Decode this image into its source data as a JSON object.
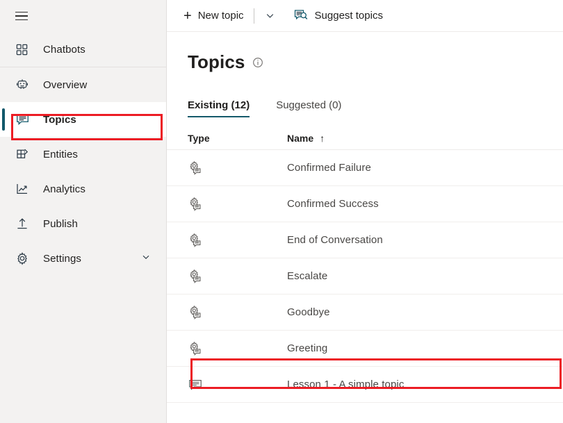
{
  "sidebar": {
    "menu_toggle": "hamburger-icon",
    "items": [
      {
        "label": "Chatbots",
        "icon": "grid-icon",
        "selected": false,
        "chevron": false
      },
      {
        "label": "Overview",
        "icon": "bot-icon",
        "selected": false,
        "chevron": false
      },
      {
        "label": "Topics",
        "icon": "speech-bubble-icon",
        "selected": true,
        "chevron": false
      },
      {
        "label": "Entities",
        "icon": "entities-icon",
        "selected": false,
        "chevron": false
      },
      {
        "label": "Analytics",
        "icon": "chart-line-icon",
        "selected": false,
        "chevron": false
      },
      {
        "label": "Publish",
        "icon": "upload-icon",
        "selected": false,
        "chevron": false
      },
      {
        "label": "Settings",
        "icon": "gear-icon",
        "selected": false,
        "chevron": true
      }
    ]
  },
  "toolbar": {
    "new_topic_label": "New topic",
    "new_topic_icon": "plus-icon",
    "new_topic_caret_icon": "chevron-down-icon",
    "suggest_topics_label": "Suggest topics",
    "suggest_topics_icon": "suggest-topics-icon"
  },
  "page": {
    "title": "Topics",
    "info_icon": "info-icon"
  },
  "tabs": [
    {
      "label": "Existing (12)",
      "active": true
    },
    {
      "label": "Suggested (0)",
      "active": false
    }
  ],
  "table": {
    "columns": [
      {
        "key": "type",
        "label": "Type",
        "sort": ""
      },
      {
        "key": "name",
        "label": "Name",
        "sort": "↑"
      }
    ],
    "rows": [
      {
        "type_icon": "system-topic-icon",
        "name": "Confirmed Failure",
        "highlighted": false
      },
      {
        "type_icon": "system-topic-icon",
        "name": "Confirmed Success",
        "highlighted": false
      },
      {
        "type_icon": "system-topic-icon",
        "name": "End of Conversation",
        "highlighted": false
      },
      {
        "type_icon": "system-topic-icon",
        "name": "Escalate",
        "highlighted": false
      },
      {
        "type_icon": "system-topic-icon",
        "name": "Goodbye",
        "highlighted": false
      },
      {
        "type_icon": "system-topic-icon",
        "name": "Greeting",
        "highlighted": true
      },
      {
        "type_icon": "custom-topic-icon",
        "name": "Lesson 1 - A simple topic",
        "highlighted": false
      }
    ]
  },
  "annotations": [
    {
      "name": "sidebar-topics-highlight",
      "color": "#ec1c24"
    },
    {
      "name": "greeting-row-highlight",
      "color": "#ec1c24"
    }
  ],
  "colors": {
    "accent_teal": "#14596a",
    "annotation_red": "#ec1c24",
    "sidebar_bg": "#f3f2f1"
  }
}
